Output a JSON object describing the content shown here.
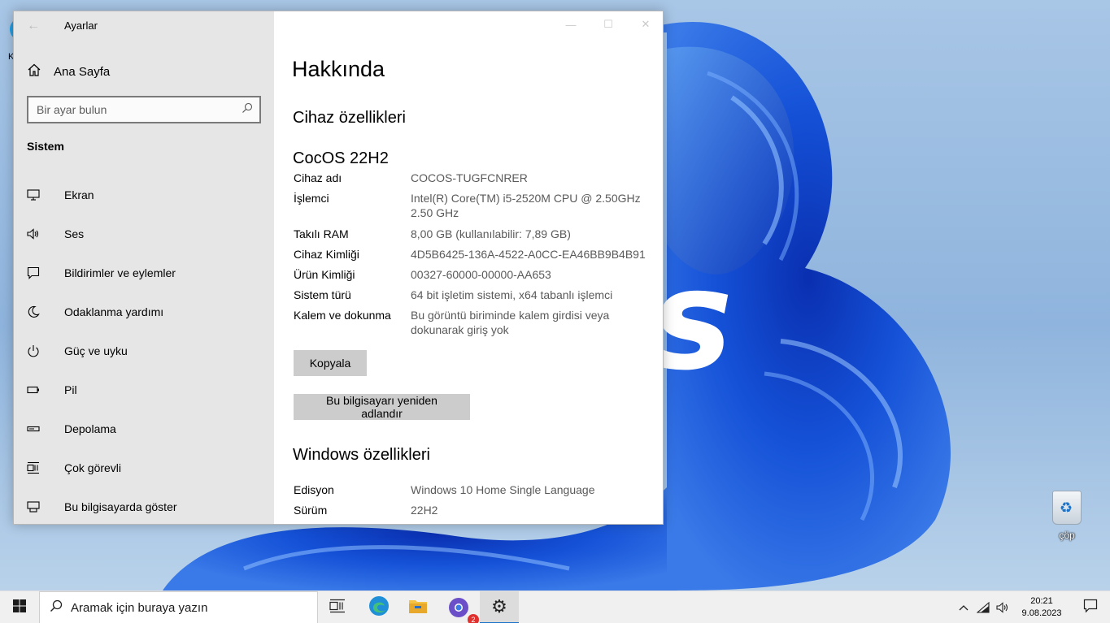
{
  "window": {
    "title": "Ayarlar",
    "sidebar": {
      "home_label": "Ana Sayfa",
      "search_placeholder": "Bir ayar bulun",
      "section": "Sistem",
      "items": [
        {
          "label": "Ekran",
          "icon": "monitor-icon"
        },
        {
          "label": "Ses",
          "icon": "speaker-icon"
        },
        {
          "label": "Bildirimler ve eylemler",
          "icon": "notification-icon"
        },
        {
          "label": "Odaklanma yardımı",
          "icon": "moon-icon"
        },
        {
          "label": "Güç ve uyku",
          "icon": "power-icon"
        },
        {
          "label": "Pil",
          "icon": "battery-icon"
        },
        {
          "label": "Depolama",
          "icon": "storage-icon"
        },
        {
          "label": "Çok görevli",
          "icon": "multitasking-icon"
        },
        {
          "label": "Bu bilgisayarda göster",
          "icon": "projecting-icon"
        }
      ]
    },
    "main": {
      "page_title": "Hakkında",
      "device_specs_title": "Cihaz özellikleri",
      "device_name": "CocOS 22H2",
      "specs": [
        {
          "key": "Cihaz adı",
          "value": "COCOS-TUGFCNRER"
        },
        {
          "key": "İşlemci",
          "value": "Intel(R) Core(TM) i5-2520M CPU @ 2.50GHz 2.50 GHz"
        },
        {
          "key": "Takılı RAM",
          "value": "8,00 GB (kullanılabilir: 7,89 GB)"
        },
        {
          "key": "Cihaz Kimliği",
          "value": "4D5B6425-136A-4522-A0CC-EA46BB9B4B91"
        },
        {
          "key": "Ürün Kimliği",
          "value": "00327-60000-00000-AA653"
        },
        {
          "key": "Sistem türü",
          "value": "64 bit işletim sistemi, x64 tabanlı işlemci"
        },
        {
          "key": "Kalem ve dokunma",
          "value": "Bu görüntü biriminde kalem girdisi veya dokunarak giriş yok"
        }
      ],
      "copy_button": "Kopyala",
      "rename_button": "Bu bilgisayarı yeniden adlandır",
      "windows_specs_title": "Windows özellikleri",
      "windows_specs": [
        {
          "key": "Edisyon",
          "value": "Windows 10 Home Single Language"
        },
        {
          "key": "Sürüm",
          "value": "22H2"
        }
      ]
    }
  },
  "desktop": {
    "wallpaper_text": "s",
    "recycle_bin_label": "çöp",
    "left_icon_label": "K"
  },
  "taskbar": {
    "search_placeholder": "Aramak için buraya yazın",
    "chrome_badge": "2",
    "time": "20:21",
    "date": "9.08.2023"
  },
  "colors": {
    "accent": "#1a73c9",
    "sidebar_bg": "#e6e6e6",
    "button_bg": "#cccccc",
    "wallpaper_blue": "#1748c6"
  }
}
